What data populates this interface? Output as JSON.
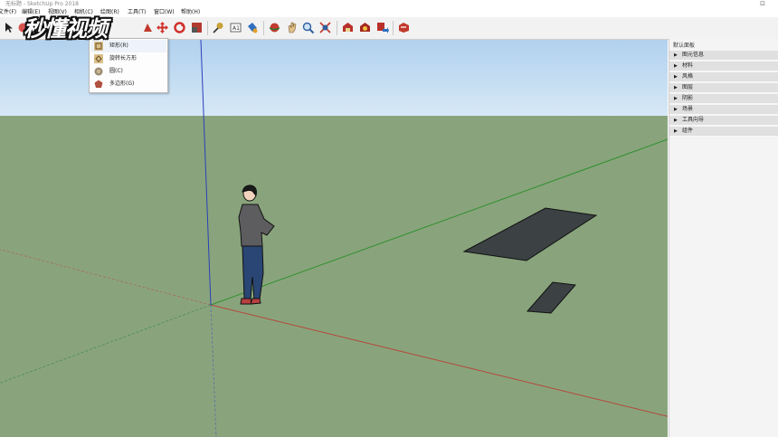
{
  "window": {
    "title": "无标题 - SketchUp Pro 2018"
  },
  "menu": [
    {
      "label": "文件(F)"
    },
    {
      "label": "编辑(E)"
    },
    {
      "label": "视图(V)"
    },
    {
      "label": "相机(C)"
    },
    {
      "label": "绘图(R)"
    },
    {
      "label": "工具(T)"
    },
    {
      "label": "窗口(W)"
    },
    {
      "label": "帮助(H)"
    }
  ],
  "dropdown": {
    "items": [
      {
        "label": "矩形(R)",
        "icon": "rectangle-icon"
      },
      {
        "label": "旋转长方形",
        "icon": "rotated-rectangle-icon"
      },
      {
        "label": "圆(C)",
        "icon": "circle-icon"
      },
      {
        "label": "多边形(G)",
        "icon": "polygon-icon"
      }
    ]
  },
  "tray": {
    "title": "默认面板",
    "panels": [
      {
        "label": "图元信息"
      },
      {
        "label": "材料"
      },
      {
        "label": "风格"
      },
      {
        "label": "图层"
      },
      {
        "label": "阴影"
      },
      {
        "label": "场景"
      },
      {
        "label": "工具向导"
      },
      {
        "label": "组件"
      }
    ]
  },
  "watermark": {
    "text": "秒懂视频"
  },
  "colors": {
    "sky": "#c3ddf2",
    "ground": "#89a47c",
    "rect_fill": "#3c4144"
  }
}
